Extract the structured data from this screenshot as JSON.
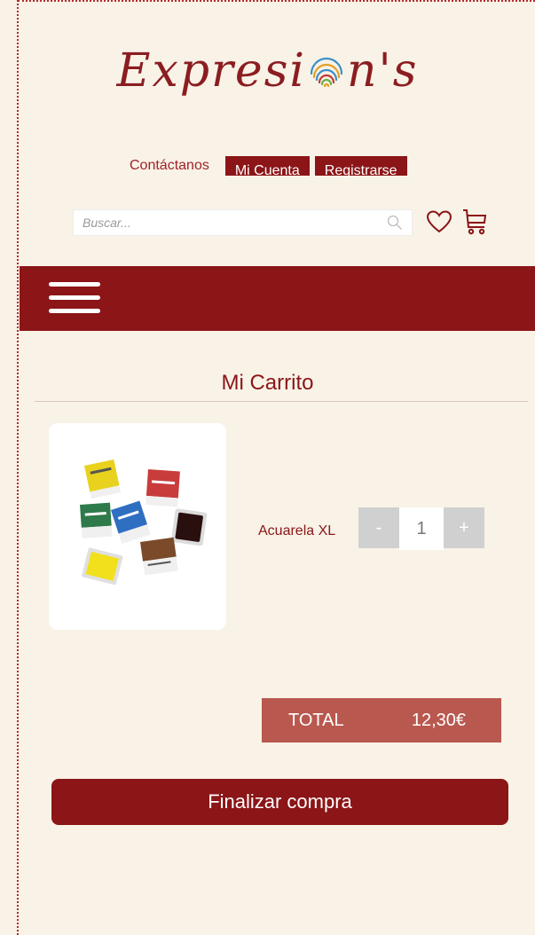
{
  "brand": {
    "logo_left": "Expresi",
    "logo_right": "n's",
    "color": "#8b1d20"
  },
  "topnav": {
    "contact": "Contáctanos",
    "account": "Mi Cuenta",
    "register": "Registrarse"
  },
  "search": {
    "placeholder": "Buscar...",
    "value": "",
    "icon": "search-icon"
  },
  "icons": {
    "wishlist": "heart-icon",
    "cart": "cart-icon",
    "menu": "hamburger-icon"
  },
  "cart": {
    "title": "Mi Carrito",
    "items": [
      {
        "name": "Acuarela XL",
        "quantity": "1",
        "image": "watercolor-pans-image"
      }
    ],
    "minus": "-",
    "plus": "+",
    "total_label": "TOTAL",
    "total_value": "12,30€",
    "checkout": "Finalizar compra"
  },
  "colors": {
    "primary": "#8b1517",
    "background": "#f8f2e7",
    "total_bg": "#b9584f",
    "stepper": "#d0d0d0"
  }
}
